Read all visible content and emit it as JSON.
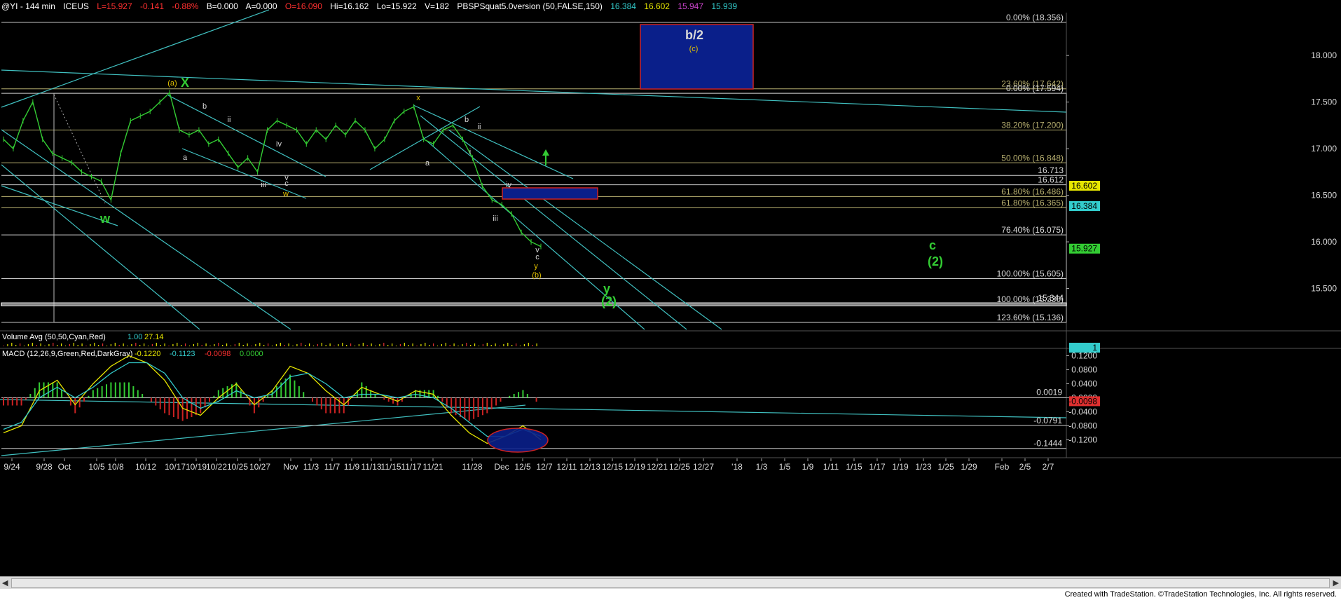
{
  "header": {
    "symbol": "@YI - 144 min",
    "exchange": "ICEUS",
    "last": "L=15.927",
    "change": "-0.141",
    "change_pct": "-0.88%",
    "bid": "B=0.000",
    "ask": "A=0.000",
    "open": "O=16.090",
    "high": "Hi=16.162",
    "low": "Lo=15.922",
    "volume": "V=182",
    "indicator": "PBSPSquat5.0version (50,FALSE,150)",
    "ind_v1": "16.384",
    "ind_v2": "16.602",
    "ind_v3": "15.947",
    "ind_v4": "15.939"
  },
  "colors": {
    "background": "#000000",
    "price": "#33cc33",
    "channel": "#40c0c0",
    "fib": "#b8b070",
    "box_fill": "#0a1f8a",
    "box_border": "#cc2222",
    "wave_green": "#33cc33",
    "wave_yellow": "#e0c000",
    "wave_white": "#d8d8d8"
  },
  "chart_data": [
    {
      "type": "line",
      "title": "",
      "y_range": [
        15.06,
        18.46
      ],
      "y_ticks": [
        "18.000",
        "17.500",
        "17.000",
        "16.500",
        "16.000",
        "15.500"
      ],
      "x_ticks": [
        "9/24",
        "9/28",
        "Oct",
        "10/5",
        "10/8",
        "10/12",
        "10/17",
        "10/19",
        "10/22",
        "10/25",
        "10/27",
        "Nov",
        "11/3",
        "11/7",
        "11/9",
        "11/13",
        "11/15",
        "11/17",
        "11/21",
        "11/28",
        "Dec",
        "12/5",
        "12/7",
        "12/11",
        "12/13",
        "12/15",
        "12/19",
        "12/21",
        "12/25",
        "12/27",
        "'18",
        "1/3",
        "1/5",
        "1/9",
        "1/11",
        "1/15",
        "1/17",
        "1/19",
        "1/23",
        "1/25",
        "1/29",
        "Feb",
        "2/5",
        "2/7"
      ],
      "series": [
        {
          "values": [
            17.1,
            17.0,
            17.3,
            17.5,
            17.1,
            16.95,
            16.9,
            16.85,
            16.75,
            16.7,
            16.65,
            16.45,
            16.95,
            17.3,
            17.35,
            17.4,
            17.5,
            17.6,
            17.2,
            17.15,
            17.2,
            17.05,
            17.1,
            16.95,
            16.8,
            16.9,
            16.75,
            17.2,
            17.3,
            17.25,
            17.2,
            17.05,
            17.2,
            17.1,
            17.25,
            17.15,
            17.3,
            17.2,
            17.0,
            17.1,
            17.3,
            17.4,
            17.45,
            17.1,
            17.05,
            17.2,
            17.25,
            17.1,
            16.9,
            16.6,
            16.45,
            16.4,
            16.3,
            16.1,
            16.0,
            15.95
          ]
        }
      ],
      "fib_levels": [
        {
          "label": "0.00% (18.356)",
          "value": 18.356
        },
        {
          "label": "23.60% (17.642)",
          "value": 17.642
        },
        {
          "label": "0.00% (17.594)",
          "value": 17.594
        },
        {
          "label": "38.20% (17.200)",
          "value": 17.2
        },
        {
          "label": "50.00% (16.848)",
          "value": 16.848
        },
        {
          "label": "16.713",
          "value": 16.713
        },
        {
          "label": "16.612",
          "value": 16.612
        },
        {
          "label": "61.80% (16.486)",
          "value": 16.486
        },
        {
          "label": "61.80% (16.365)",
          "value": 16.365
        },
        {
          "label": "76.40% (16.075)",
          "value": 16.075
        },
        {
          "label": "100.00% (15.605)",
          "value": 15.605
        },
        {
          "label": "100.00% (15.330)",
          "value": 15.33
        },
        {
          "label": "15.344",
          "value": 15.344
        },
        {
          "label": "123.60% (15.136)",
          "value": 15.136
        }
      ],
      "price_badges": [
        {
          "label": "16.602",
          "value": 16.602,
          "color": "#e6e600",
          "text": "#000000"
        },
        {
          "label": "16.384",
          "value": 16.384,
          "color": "#33cccc",
          "text": "#000000"
        },
        {
          "label": "15.927",
          "value": 15.927,
          "color": "#33cc33",
          "text": "#000000"
        }
      ],
      "wave_labels": [
        {
          "text": "w",
          "color": "green",
          "big": true
        },
        {
          "text": "(a)",
          "color": "yellow"
        },
        {
          "text": "X",
          "color": "green",
          "big": true
        },
        {
          "text": "a",
          "color": "white"
        },
        {
          "text": "b",
          "color": "white"
        },
        {
          "text": "ii",
          "color": "white"
        },
        {
          "text": "iii",
          "color": "white"
        },
        {
          "text": "iv",
          "color": "white"
        },
        {
          "text": "v",
          "color": "white"
        },
        {
          "text": "c",
          "color": "white"
        },
        {
          "text": "w",
          "color": "yellow"
        },
        {
          "text": "x",
          "color": "yellow"
        },
        {
          "text": "a",
          "color": "white"
        },
        {
          "text": "b",
          "color": "white"
        },
        {
          "text": "i",
          "color": "white"
        },
        {
          "text": "ii",
          "color": "white"
        },
        {
          "text": "iii",
          "color": "white"
        },
        {
          "text": "iv",
          "color": "white"
        },
        {
          "text": "v",
          "color": "white"
        },
        {
          "text": "c",
          "color": "white"
        },
        {
          "text": "y",
          "color": "yellow"
        },
        {
          "text": "(b)",
          "color": "yellow"
        },
        {
          "text": "y",
          "color": "green",
          "big": true
        },
        {
          "text": "(2)",
          "color": "green",
          "big": true
        },
        {
          "text": "c",
          "color": "green",
          "big": true
        },
        {
          "text": "(2)",
          "color": "green",
          "big": true
        },
        {
          "text": "b/2",
          "color": "white",
          "big": true
        },
        {
          "text": "(c)",
          "color": "yellow"
        }
      ]
    },
    {
      "type": "bar",
      "title": "Volume Avg (50,50,Cyan,Red)",
      "values_label": [
        "1.00",
        "27.14"
      ],
      "badge": "1"
    },
    {
      "type": "line",
      "title": "MACD (12,26,9,Green,Red,DarkGray)",
      "values_label": [
        "-0.1220",
        "-0.1123",
        "-0.0098",
        "0.0000"
      ],
      "y_range": [
        -0.165,
        0.135
      ],
      "y_ticks": [
        "0.1200",
        "0.0800",
        "0.0400",
        "0.0000",
        "-0.0400",
        "-0.0800",
        "-0.1200"
      ],
      "annotations": [
        "0.0019",
        "-0.0791",
        "-0.1444"
      ],
      "badge": "-0.0098",
      "series": [
        {
          "name": "MACD",
          "values": [
            -0.1,
            -0.08,
            0.02,
            0.05,
            -0.02,
            0.04,
            0.09,
            0.12,
            0.1,
            0.05,
            -0.03,
            -0.05,
            0.0,
            0.04,
            -0.02,
            0.02,
            0.09,
            0.07,
            0.02,
            -0.02,
            0.03,
            0.01,
            -0.01,
            0.02,
            0.01,
            -0.05,
            -0.1,
            -0.13,
            -0.11,
            -0.08,
            -0.12
          ]
        },
        {
          "name": "Signal",
          "values": [
            -0.09,
            -0.07,
            0.0,
            0.03,
            0.0,
            0.03,
            0.07,
            0.1,
            0.1,
            0.07,
            0.0,
            -0.03,
            -0.01,
            0.02,
            0.0,
            0.01,
            0.06,
            0.07,
            0.04,
            0.0,
            0.01,
            0.01,
            0.0,
            0.01,
            0.0,
            -0.03,
            -0.07,
            -0.11,
            -0.11,
            -0.09,
            -0.11
          ]
        }
      ]
    }
  ],
  "footer": {
    "credit": "Created with TradeStation. ©TradeStation Technologies, Inc. All rights reserved."
  }
}
